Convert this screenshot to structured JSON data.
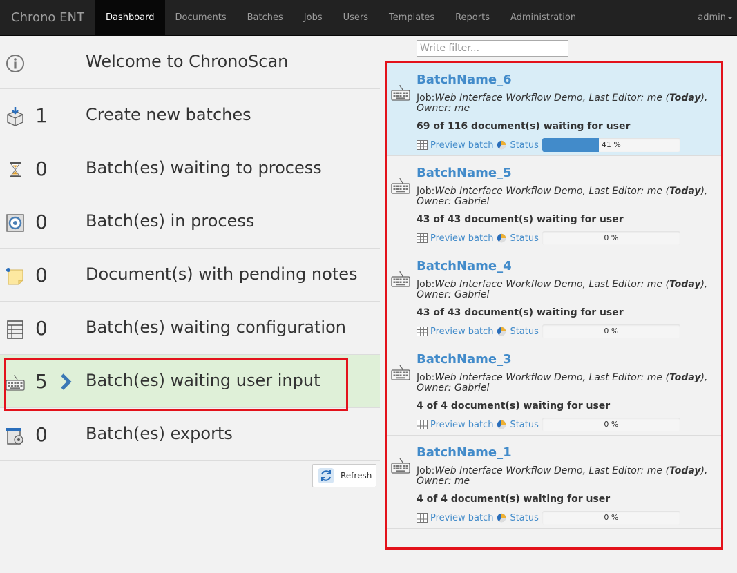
{
  "navbar": {
    "brand": "Chrono ENT",
    "items": [
      {
        "label": "Dashboard",
        "active": true
      },
      {
        "label": "Documents"
      },
      {
        "label": "Batches"
      },
      {
        "label": "Jobs"
      },
      {
        "label": "Users"
      },
      {
        "label": "Templates"
      },
      {
        "label": "Reports"
      },
      {
        "label": "Administration"
      }
    ],
    "user": "admin"
  },
  "dashboard": {
    "rows": [
      {
        "icon": "info-icon",
        "count": "",
        "label": "Welcome to ChronoScan"
      },
      {
        "icon": "new-batch-box-icon",
        "count": "1",
        "label": "Create new batches"
      },
      {
        "icon": "hourglass-icon",
        "count": "0",
        "label": "Batch(es) waiting to process"
      },
      {
        "icon": "process-gear-icon",
        "count": "0",
        "label": "Batch(es) in process"
      },
      {
        "icon": "sticky-note-icon",
        "count": "0",
        "label": "Document(s) with pending notes"
      },
      {
        "icon": "configuration-list-icon",
        "count": "0",
        "label": "Batch(es) waiting configuration"
      },
      {
        "icon": "keyboard-icon",
        "count": "5",
        "label": "Batch(es) waiting user input",
        "selected": true
      },
      {
        "icon": "export-icon",
        "count": "0",
        "label": "Batch(es) exports"
      }
    ],
    "refresh_label": "Refresh"
  },
  "filter": {
    "placeholder": "Write filter..."
  },
  "batches": [
    {
      "name": "BatchName_6",
      "job_prefix": "Job:",
      "job_name": "Web Interface Workflow Demo",
      "editor_prefix": ", Last Editor: ",
      "editor": "me",
      "date_open": " (",
      "date": "Today",
      "date_close": "),",
      "owner_prefix": "Owner: ",
      "owner": "me",
      "waiting": "69 of 116 document(s) waiting for user",
      "preview_label": "Preview batch",
      "status_label": "Status",
      "progress": 41,
      "progress_text": "41 %",
      "highlight": true
    },
    {
      "name": "BatchName_5",
      "job_prefix": "Job:",
      "job_name": "Web Interface Workflow Demo",
      "editor_prefix": ", Last Editor: ",
      "editor": "me",
      "date_open": " (",
      "date": "Today",
      "date_close": "),",
      "owner_prefix": "Owner: ",
      "owner": "Gabriel",
      "waiting": "43 of 43 document(s) waiting for user",
      "preview_label": "Preview batch",
      "status_label": "Status",
      "progress": 0,
      "progress_text": "0 %"
    },
    {
      "name": "BatchName_4",
      "job_prefix": "Job:",
      "job_name": "Web Interface Workflow Demo",
      "editor_prefix": ", Last Editor: ",
      "editor": "me",
      "date_open": " (",
      "date": "Today",
      "date_close": "),",
      "owner_prefix": "Owner: ",
      "owner": "Gabriel",
      "waiting": "43 of 43 document(s) waiting for user",
      "preview_label": "Preview batch",
      "status_label": "Status",
      "progress": 0,
      "progress_text": "0 %"
    },
    {
      "name": "BatchName_3",
      "job_prefix": "Job:",
      "job_name": "Web Interface Workflow Demo",
      "editor_prefix": ", Last Editor: ",
      "editor": "me",
      "date_open": " (",
      "date": "Today",
      "date_close": "),",
      "owner_prefix": "Owner: ",
      "owner": "Gabriel",
      "waiting": "4 of 4 document(s) waiting for user",
      "preview_label": "Preview batch",
      "status_label": "Status",
      "progress": 0,
      "progress_text": "0 %"
    },
    {
      "name": "BatchName_1",
      "job_prefix": "Job:",
      "job_name": "Web Interface Workflow Demo",
      "editor_prefix": ", Last Editor: ",
      "editor": "me",
      "date_open": " (",
      "date": "Today",
      "date_close": "),",
      "owner_prefix": "Owner: ",
      "owner": "me",
      "waiting": "4 of 4 document(s) waiting for user",
      "preview_label": "Preview batch",
      "status_label": "Status",
      "progress": 0,
      "progress_text": "0 %"
    }
  ],
  "colors": {
    "accent": "#428bca",
    "highlight_row": "#d9edf7",
    "selected_row": "#dff0d8",
    "annotation_red": "#e3121b",
    "navbar": "#222222"
  }
}
